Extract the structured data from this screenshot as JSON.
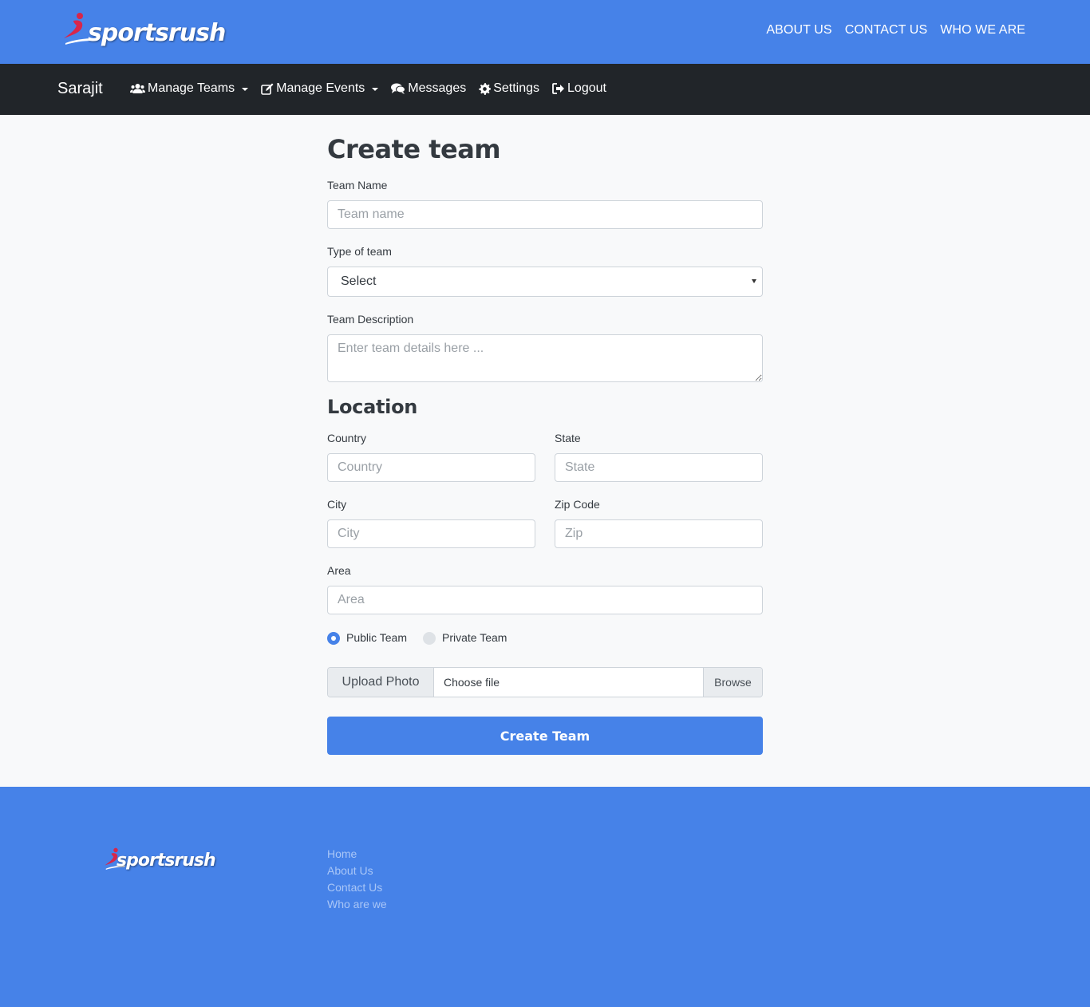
{
  "brand": {
    "logo_text": "sportsrush",
    "colors": {
      "primary": "#4682e8",
      "navbar": "#212529",
      "swoosh": "#d7264a"
    }
  },
  "top_nav": {
    "links": [
      "ABOUT US",
      "CONTACT US",
      "WHO WE ARE"
    ]
  },
  "navbar": {
    "user_name": "Sarajit",
    "items": [
      {
        "label": "Manage Teams",
        "icon": "users-icon",
        "dropdown": true
      },
      {
        "label": "Manage Events",
        "icon": "edit-icon",
        "dropdown": true
      },
      {
        "label": "Messages",
        "icon": "comments-icon",
        "dropdown": false
      },
      {
        "label": "Settings",
        "icon": "gear-icon",
        "dropdown": false
      },
      {
        "label": "Logout",
        "icon": "sign-out-icon",
        "dropdown": false
      }
    ]
  },
  "form": {
    "title": "Create team",
    "team_name": {
      "label": "Team Name",
      "placeholder": "Team name"
    },
    "team_type": {
      "label": "Type of team",
      "value": "Select"
    },
    "description": {
      "label": "Team Description",
      "placeholder": "Enter team details here ..."
    },
    "location_title": "Location",
    "country": {
      "label": "Country",
      "placeholder": "Country"
    },
    "state": {
      "label": "State",
      "placeholder": "State"
    },
    "city": {
      "label": "City",
      "placeholder": "City"
    },
    "zip": {
      "label": "Zip Code",
      "placeholder": "Zip"
    },
    "area": {
      "label": "Area",
      "placeholder": "Area"
    },
    "visibility": {
      "public_label": "Public Team",
      "private_label": "Private Team",
      "selected": "public"
    },
    "upload": {
      "prepend": "Upload Photo",
      "file_label": "Choose file",
      "browse": "Browse"
    },
    "submit_label": "Create Team"
  },
  "footer": {
    "links": [
      "Home",
      "About Us",
      "Contact Us",
      "Who are we"
    ]
  }
}
